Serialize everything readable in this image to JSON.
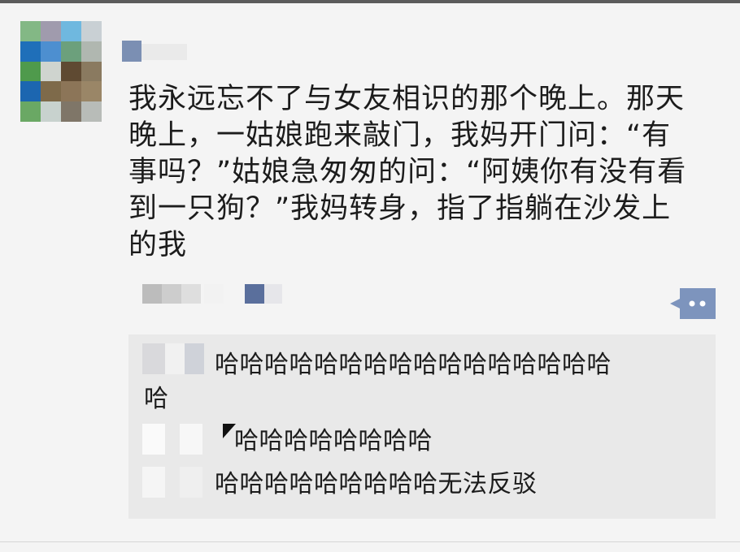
{
  "post": {
    "lines": [
      "我永远忘不了与女友相识的那个晚上。那天",
      "晚上，一姑娘跑来敲门，我妈开门问：“有",
      "事吗？”姑娘急匆匆的问：“阿姨你有没有看",
      "到一只狗？”我妈转身，指了指躺在沙发上",
      "的我"
    ]
  },
  "comments": [
    {
      "text_line1": "哈哈哈哈哈哈哈哈哈哈哈哈哈哈哈哈",
      "text_line2": "哈"
    },
    {
      "text_line1": "哈哈哈哈哈哈哈哈"
    },
    {
      "text_line1": "哈哈哈哈哈哈哈哈哈无法反驳"
    }
  ],
  "icons": {
    "comment_button": "comment-bubble-icon"
  },
  "colors": {
    "background": "#f4f4f4",
    "comments_background": "#e9e9e9",
    "comment_button": "#7d94bd"
  }
}
